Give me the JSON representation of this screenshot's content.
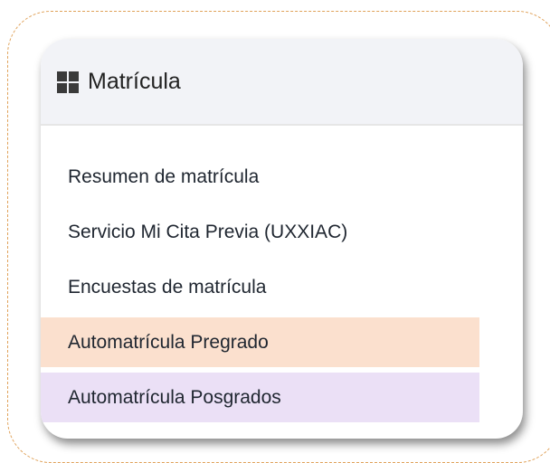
{
  "panel": {
    "title": "Matrícula",
    "icon": "grid-icon"
  },
  "menu": {
    "items": [
      {
        "label": "Resumen de matrícula",
        "highlight": null
      },
      {
        "label": "Servicio Mi Cita Previa (UXXIAC)",
        "highlight": null
      },
      {
        "label": "Encuestas de matrícula",
        "highlight": null
      },
      {
        "label": "Automatrícula Pregrado",
        "highlight": "#fbe0ce"
      },
      {
        "label": "Automatrícula Posgrados",
        "highlight": "#ebe0f6"
      }
    ]
  },
  "colors": {
    "frame_border": "#e0a25a",
    "header_bg": "#f2f3f7"
  }
}
